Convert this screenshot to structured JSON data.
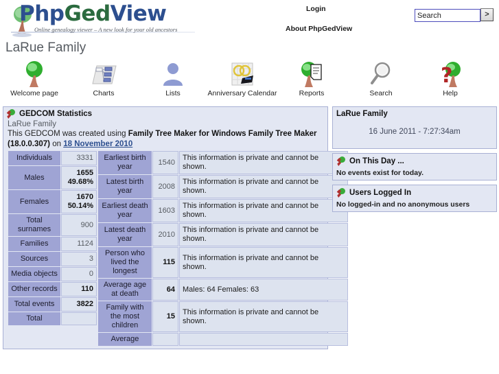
{
  "header": {
    "logo": {
      "part1": "Php",
      "part2": "Ged",
      "part3": "View",
      "tagline": "Online genealogy viewer – A new look for your old ancestors",
      "tree_icon": "tree-icon"
    },
    "login_label": "Login",
    "about_label": "About PhpGedView",
    "search": {
      "value": "Search",
      "placeholder": "Search",
      "go_label": ">",
      "icon": "search-submit-icon"
    }
  },
  "page_title": "LaRue Family",
  "nav": {
    "items": [
      {
        "label": "Welcome page",
        "icon": "green-tree-icon"
      },
      {
        "label": "Charts",
        "icon": "chart-diagram-icon"
      },
      {
        "label": "Lists",
        "icon": "person-silhouette-icon"
      },
      {
        "label": "Anniversary Calendar",
        "icon": "calendar-rings-icon"
      },
      {
        "label": "Reports",
        "icon": "tree-document-icon"
      },
      {
        "label": "Search",
        "icon": "magnifier-icon"
      },
      {
        "label": "Help",
        "icon": "question-mark-tree-icon"
      }
    ]
  },
  "stats_block": {
    "icon": "pgv-sprout-icon",
    "title": "GEDCOM Statistics",
    "subtitle": "LaRue Family",
    "created_prefix": "This GEDCOM was created using ",
    "created_software": "Family Tree Maker for Windows Family Tree Maker (18.0.0.307)",
    "created_on_label": " on ",
    "created_date": "18 November 2010",
    "table_a": [
      {
        "label": "Individuals",
        "value": "3331",
        "bold": false
      },
      {
        "label": "Males",
        "value": "1655\n49.68%",
        "bold": true
      },
      {
        "label": "Females",
        "value": "1670\n50.14%",
        "bold": true
      },
      {
        "label": "Total surnames",
        "value": "900",
        "bold": false
      },
      {
        "label": "Families",
        "value": "1124",
        "bold": false
      },
      {
        "label": "Sources",
        "value": "3",
        "bold": false
      },
      {
        "label": "Media objects",
        "value": "0",
        "bold": false
      },
      {
        "label": "Other records",
        "value": "110",
        "bold": true
      },
      {
        "label": "Total events",
        "value": "3822",
        "bold": true
      },
      {
        "label": "Total",
        "value": "",
        "bold": false
      }
    ],
    "table_b": [
      {
        "label": "Earliest birth year",
        "value": "1540",
        "bold": false,
        "detail": "This information is private and cannot be shown."
      },
      {
        "label": "Latest birth year",
        "value": "2008",
        "bold": false,
        "detail": "This information is private and cannot be shown."
      },
      {
        "label": "Earliest death year",
        "value": "1603",
        "bold": false,
        "detail": "This information is private and cannot be shown."
      },
      {
        "label": "Latest death year",
        "value": "2010",
        "bold": false,
        "detail": "This information is private and cannot be shown."
      },
      {
        "label": "Person who lived the longest",
        "value": "115",
        "bold": true,
        "detail": "This information is private and cannot be shown."
      },
      {
        "label": "Average age at death",
        "value": "64",
        "bold": true,
        "detail": "Males: 64   Females: 63"
      },
      {
        "label": "Family with the most children",
        "value": "15",
        "bold": true,
        "detail": "This information is private and cannot be shown."
      },
      {
        "label": "Average",
        "value": "",
        "bold": false,
        "detail": ""
      }
    ]
  },
  "sidebar": {
    "gedcom_panel": {
      "title": "LaRue Family",
      "datetime": "16 June 2011 - 7:27:34am"
    },
    "on_this_day": {
      "icon": "pgv-sprout-icon",
      "title": "On This Day ...",
      "body": "No events exist for today."
    },
    "users_logged_in": {
      "icon": "pgv-sprout-icon",
      "title": "Users Logged In",
      "body": "No logged-in and no anonymous users"
    }
  },
  "colors": {
    "header_cell": "#9fa4d4",
    "value_cell": "#dde3ef",
    "panel_bg": "#e3e7f3",
    "panel_border": "#a8b0d4",
    "link_blue": "#2d4f8f",
    "title_gray": "#555a60"
  }
}
